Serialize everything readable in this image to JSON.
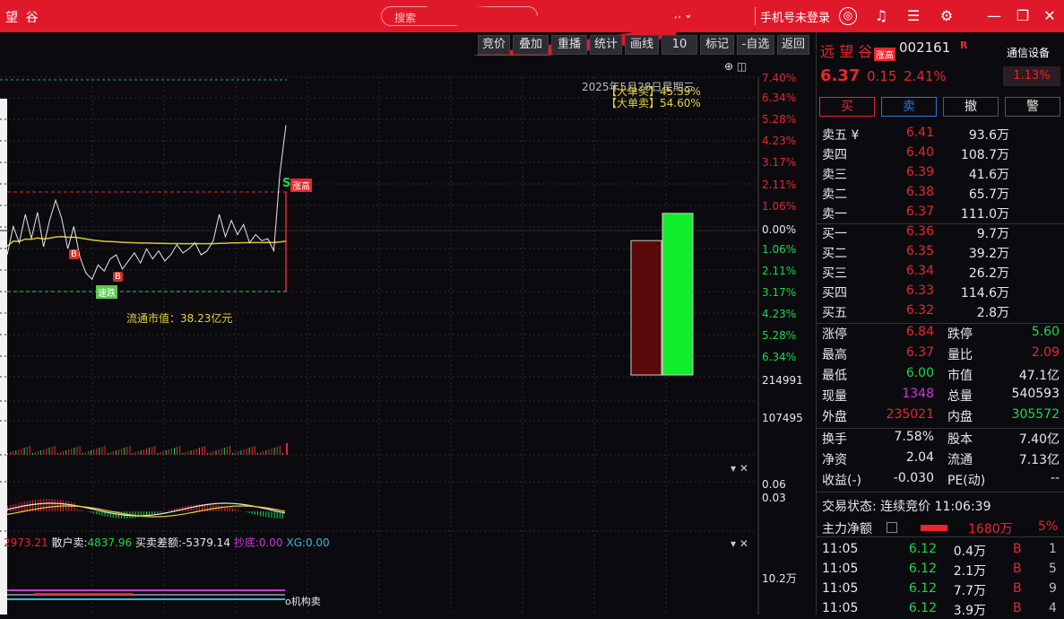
{
  "title_bar": {
    "app_title": "望 谷",
    "search_placeholder": "搜索",
    "dropdown_label": "n ∨",
    "login_text": "手机号未登录",
    "window_controls": [
      "—",
      "❐",
      "✕"
    ]
  },
  "toolbar": {
    "buttons": [
      "竞价",
      "叠加",
      "重播",
      "统计",
      "画线",
      "10",
      "标记",
      "-自选",
      "返回"
    ]
  },
  "chart": {
    "date_label": "2025年5月28日星期三",
    "big_buy_label": "【大单买】",
    "big_buy_value": "45.39%",
    "big_sell_label": "【大单卖】",
    "big_sell_value": "54.60%",
    "float_mv_label": "流通市值：38.23亿元",
    "marker_b": "B",
    "marker_s": "S",
    "marker_high": "涨高",
    "marker_low": "速跌",
    "right_axis_up": [
      "7.40%",
      "6.34%",
      "5.28%",
      "4.23%",
      "3.17%",
      "2.11%",
      "1.06%"
    ],
    "right_axis_zero": "0.00%",
    "right_axis_down": [
      "1.06%",
      "2.11%",
      "3.17%",
      "4.23%",
      "5.28%",
      "6.34%"
    ],
    "volume_axis": [
      "214991",
      "107495"
    ],
    "macd_axis": [
      "0.06",
      "0.03"
    ],
    "bottom_axis": "10.2万",
    "indicator_line": {
      "big_sell": "2973.21",
      "retail_sell_label": "散户卖:",
      "retail_sell_value": "4837.96",
      "diff_label": "买卖差额:",
      "diff_value": "-5379.14",
      "chaodi_label": "抄底:",
      "chaodi_value": "0.00",
      "xg_label": "XG:",
      "xg_value": "0.00"
    },
    "bottom_legend": "o机构卖",
    "buy_sell_bars": {
      "sell": 45.39,
      "buy": 54.6
    },
    "price_line_values": [
      -1.2,
      0.2,
      -0.6,
      0.8,
      -0.4,
      0.9,
      -0.8,
      0.5,
      1.5,
      0.6,
      -0.9,
      0.2,
      -1.3,
      -2.1,
      -2.4,
      -1.7,
      -2.0,
      -1.4,
      -1.2,
      -1.9,
      -1.5,
      -1.1,
      -1.6,
      -0.9,
      -1.4,
      -1.0,
      -1.5,
      -1.2,
      -0.7,
      -1.1,
      -0.9,
      -0.6,
      -1.2,
      -1.0,
      -0.5,
      0.8,
      -0.3,
      0.5,
      -0.2,
      0.3,
      -0.6,
      -0.2,
      -0.5,
      -0.4,
      -1.0,
      2.8,
      5.2
    ],
    "colors": {
      "up": "#e8262d",
      "down": "#1bd64c",
      "avg_line": "#d6c83a",
      "price_line": "#e8e8e8"
    }
  },
  "stock": {
    "name": "远 望 谷",
    "badge": "涨高",
    "code": "002161",
    "r_mark": "R",
    "price": "6.37",
    "change": "0.15",
    "change_pct": "2.41%",
    "comm_label": "通信设备",
    "comm_pct": "1.13%",
    "action_buttons": [
      "买",
      "卖",
      "撤",
      "警"
    ]
  },
  "order_book": {
    "asks": [
      {
        "label": "卖五 ¥",
        "price": "6.41",
        "vol": "93.6万"
      },
      {
        "label": "卖四",
        "price": "6.40",
        "vol": "108.7万"
      },
      {
        "label": "卖三",
        "price": "6.39",
        "vol": "41.6万"
      },
      {
        "label": "卖二",
        "price": "6.38",
        "vol": "65.7万"
      },
      {
        "label": "卖一",
        "price": "6.37",
        "vol": "111.0万"
      }
    ],
    "bids": [
      {
        "label": "买一",
        "price": "6.36",
        "vol": "9.7万"
      },
      {
        "label": "买二",
        "price": "6.35",
        "vol": "39.2万"
      },
      {
        "label": "买三",
        "price": "6.34",
        "vol": "26.2万"
      },
      {
        "label": "买四",
        "price": "6.33",
        "vol": "114.6万"
      },
      {
        "label": "买五",
        "price": "6.32",
        "vol": "2.8万"
      }
    ]
  },
  "stats": [
    {
      "l1": "涨停",
      "v1": "6.84",
      "c1": "red",
      "l2": "跌停",
      "v2": "5.60",
      "c2": "green"
    },
    {
      "l1": "最高",
      "v1": "6.37",
      "c1": "red",
      "l2": "量比",
      "v2": "2.09",
      "c2": "red"
    },
    {
      "l1": "最低",
      "v1": "6.00",
      "c1": "green",
      "l2": "市值",
      "v2": "47.1亿",
      "c2": "white"
    },
    {
      "l1": "现量",
      "v1": "1348",
      "c1": "magenta",
      "l2": "总量",
      "v2": "540593",
      "c2": "white"
    },
    {
      "l1": "外盘",
      "v1": "235021",
      "c1": "red",
      "l2": "内盘",
      "v2": "305572",
      "c2": "green"
    },
    {
      "l1": "换手",
      "v1": "7.58%",
      "c1": "white",
      "l2": "股本",
      "v2": "7.40亿",
      "c2": "white"
    },
    {
      "l1": "净资",
      "v1": "2.04",
      "c1": "white",
      "l2": "流通",
      "v2": "7.13亿",
      "c2": "white"
    },
    {
      "l1": "收益(-)",
      "v1": "-0.030",
      "c1": "white",
      "l2": "PE(动)",
      "v2": "--",
      "c2": "white"
    }
  ],
  "trade_status": "交易状态: 连续竞价 11:06:39",
  "main_force": {
    "label": "主力净额",
    "value": "1680万",
    "pct": "5%"
  },
  "ticks": [
    {
      "time": "11:05",
      "price": "6.12",
      "vol": "0.4万",
      "side": "B",
      "n": "1"
    },
    {
      "time": "11:05",
      "price": "6.12",
      "vol": "2.1万",
      "side": "B",
      "n": "5"
    },
    {
      "time": "11:05",
      "price": "6.12",
      "vol": "7.7万",
      "side": "B",
      "n": "9"
    },
    {
      "time": "11:05",
      "price": "6.12",
      "vol": "3.9万",
      "side": "B",
      "n": "4"
    }
  ]
}
